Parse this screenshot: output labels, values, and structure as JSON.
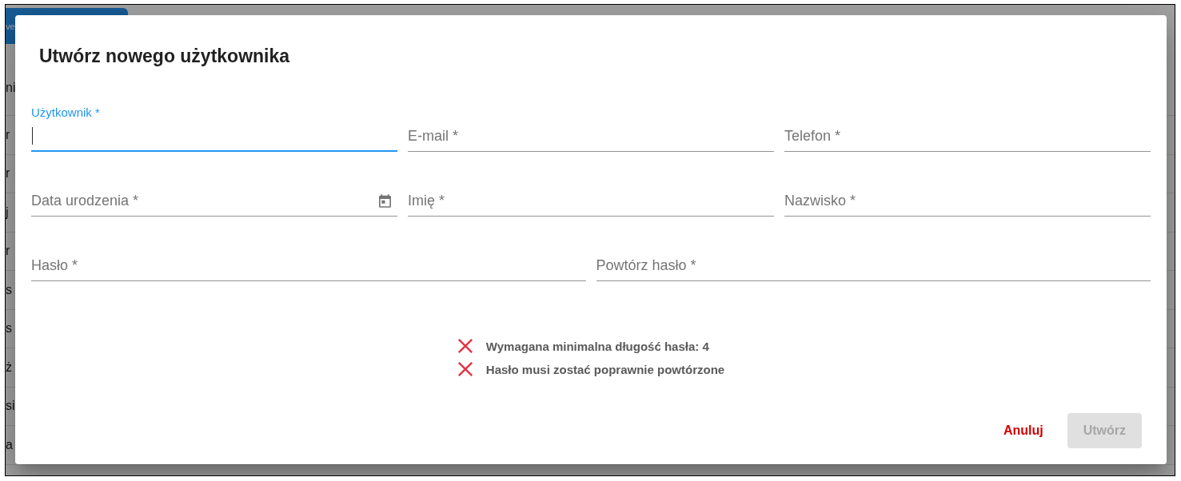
{
  "background_page": {
    "button": {
      "label": "ve"
    },
    "rows": [
      {
        "text": "ni"
      },
      {
        "text": "r"
      },
      {
        "text": "r"
      },
      {
        "text": "j"
      },
      {
        "text": "r"
      },
      {
        "text": "s"
      },
      {
        "text": "s"
      },
      {
        "text": "ż"
      },
      {
        "text": "si"
      },
      {
        "text": "a"
      }
    ]
  },
  "dialog": {
    "title": "Utwórz nowego użytkownika",
    "field_rows": [
      {
        "fields": [
          {
            "label": "Użytkownik *",
            "kind": "text",
            "focused": true
          },
          {
            "label": "E-mail *",
            "kind": "text",
            "focused": false
          },
          {
            "label": "Telefon *",
            "kind": "text",
            "focused": false
          }
        ]
      },
      {
        "fields": [
          {
            "label": "Data urodzenia *",
            "kind": "date",
            "focused": false
          },
          {
            "label": "Imię *",
            "kind": "text",
            "focused": false
          },
          {
            "label": "Nazwisko *",
            "kind": "text",
            "focused": false
          }
        ]
      },
      {
        "fields": [
          {
            "label": "Hasło *",
            "kind": "text",
            "focused": false
          },
          {
            "label": "Powtórz hasło *",
            "kind": "text",
            "focused": false
          }
        ]
      }
    ],
    "validation": [
      {
        "text": "Wymagana minimalna długość hasła: 4",
        "met": false
      },
      {
        "text": "Hasło musi zostać poprawnie powtórzone",
        "met": false
      }
    ],
    "actions": [
      {
        "label": "Anuluj",
        "kind": "text",
        "disabled": false
      },
      {
        "label": "Utwórz",
        "kind": "contained",
        "disabled": true
      }
    ]
  }
}
